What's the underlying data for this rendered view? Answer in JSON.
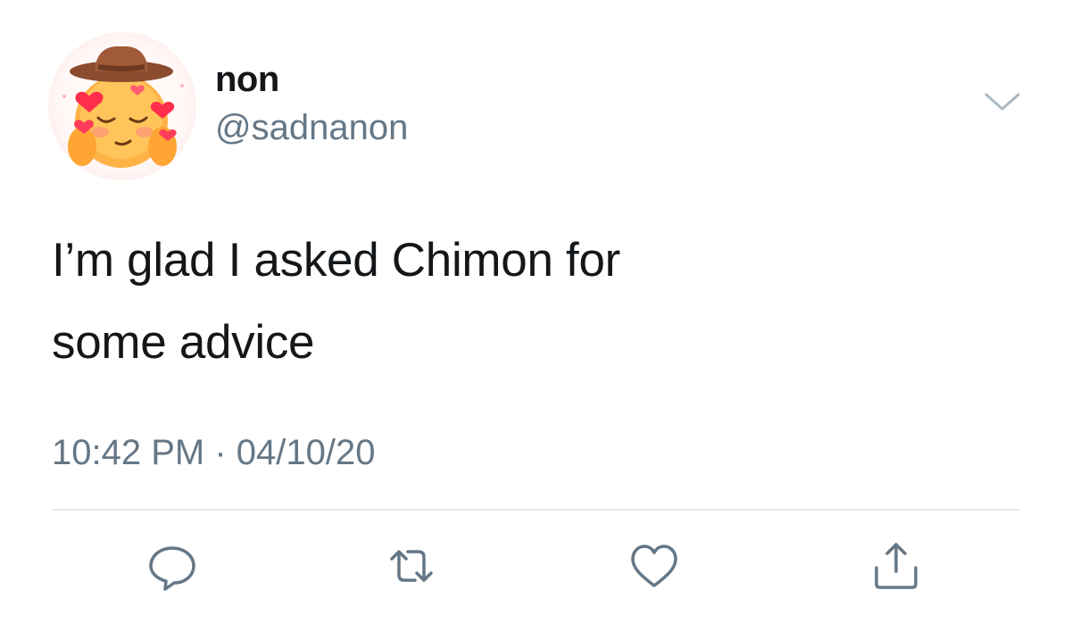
{
  "user": {
    "display_name": "non",
    "handle": "@sadnanon",
    "avatar_icon": "blushing-face-with-hearts-and-cowboy-hat-emoji"
  },
  "tweet": {
    "text_line_1": "I’m glad I asked Chimon for",
    "text_line_2": "some advice",
    "time": "10:42 PM",
    "separator": "·",
    "date": "04/10/20"
  },
  "actions": [
    {
      "name": "reply",
      "icon": "speech-bubble-icon"
    },
    {
      "name": "retweet",
      "icon": "retweet-arrows-icon"
    },
    {
      "name": "like",
      "icon": "heart-outline-icon"
    },
    {
      "name": "share",
      "icon": "share-upload-icon"
    }
  ],
  "colors": {
    "text_primary": "#14171a",
    "text_secondary": "#657786",
    "divider": "#e1e8ed",
    "icon": "#657786"
  }
}
